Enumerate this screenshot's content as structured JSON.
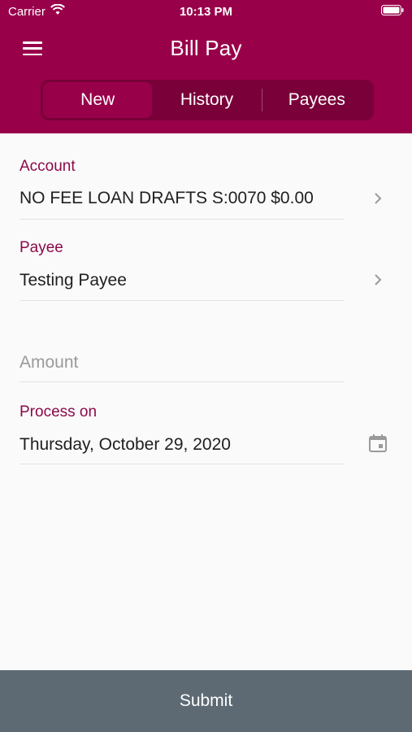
{
  "status_bar": {
    "carrier": "Carrier",
    "time": "10:13 PM",
    "wifi_icon": "wifi-icon",
    "battery_icon": "battery-icon"
  },
  "header": {
    "title": "Bill Pay",
    "menu_icon": "menu-icon",
    "background_color": "#99004a"
  },
  "tabs": [
    {
      "label": "New",
      "active": true
    },
    {
      "label": "History",
      "active": false
    },
    {
      "label": "Payees",
      "active": false
    }
  ],
  "form": {
    "account": {
      "label": "Account",
      "value": "NO FEE LOAN DRAFTS S:0070 $0.00"
    },
    "payee": {
      "label": "Payee",
      "value": "Testing Payee"
    },
    "amount": {
      "placeholder": "Amount"
    },
    "process_on": {
      "label": "Process on",
      "value": "Thursday, October 29, 2020"
    }
  },
  "submit": {
    "label": "Submit",
    "color": "#5e6a73"
  },
  "colors": {
    "accent": "#99004a",
    "label": "#8b0a4a"
  }
}
